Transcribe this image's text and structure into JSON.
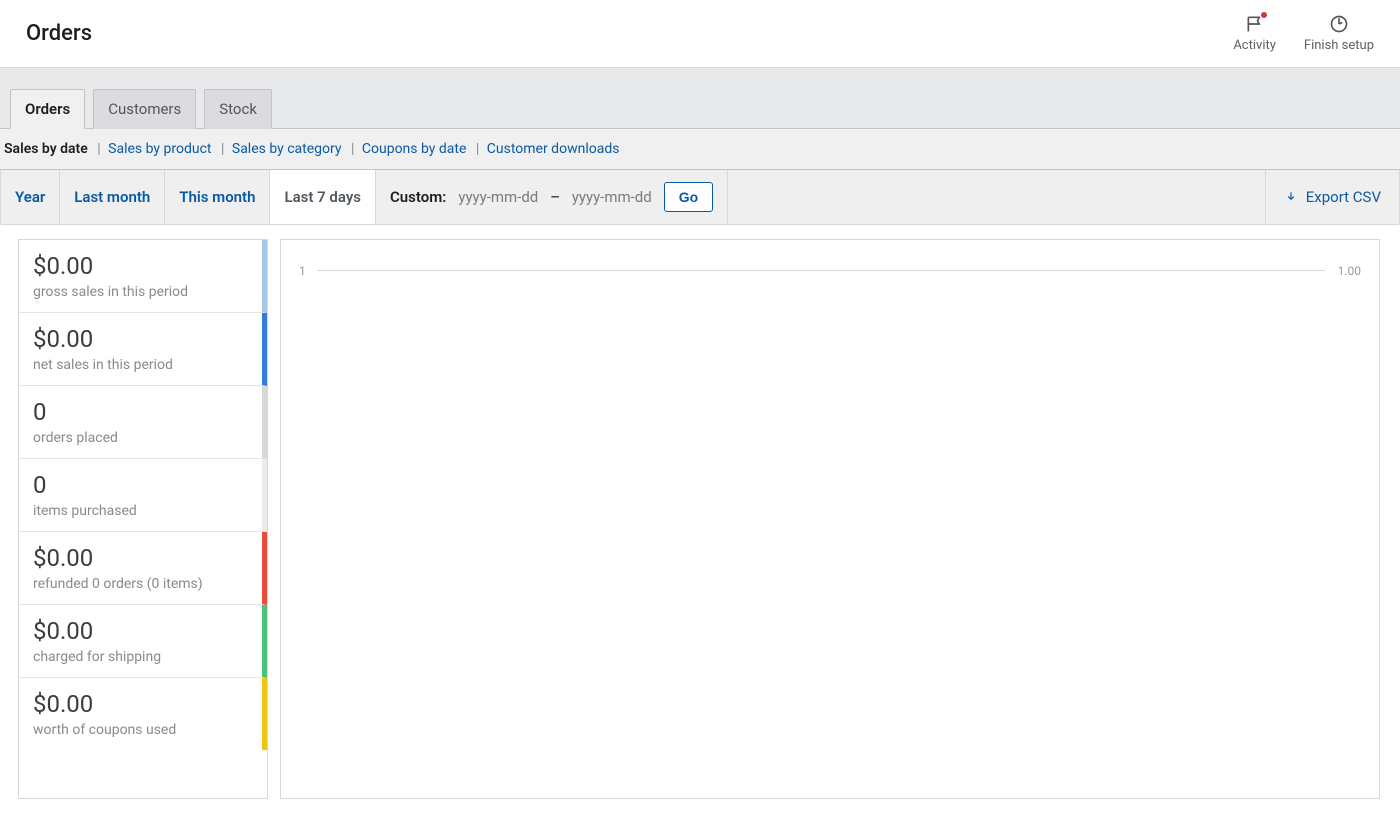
{
  "header": {
    "title": "Orders",
    "activity_label": "Activity",
    "finish_setup_label": "Finish setup"
  },
  "tabs": {
    "orders": "Orders",
    "customers": "Customers",
    "stock": "Stock"
  },
  "subnav": {
    "sales_by_date": "Sales by date",
    "sales_by_product": "Sales by product",
    "sales_by_category": "Sales by category",
    "coupons_by_date": "Coupons by date",
    "customer_downloads": "Customer downloads"
  },
  "range": {
    "year": "Year",
    "last_month": "Last month",
    "this_month": "This month",
    "last_7_days": "Last 7 days",
    "custom_label": "Custom:",
    "from_placeholder": "yyyy-mm-dd",
    "to_placeholder": "yyyy-mm-dd",
    "go": "Go",
    "export": "Export CSV"
  },
  "stats": [
    {
      "value": "$0.00",
      "label": "gross sales in this period",
      "color": "#a6c8e6"
    },
    {
      "value": "$0.00",
      "label": "net sales in this period",
      "color": "#2f7ed8"
    },
    {
      "value": "0",
      "label": "orders placed",
      "color": "#d8d8d8"
    },
    {
      "value": "0",
      "label": "items purchased",
      "color": "#eaeaea"
    },
    {
      "value": "$0.00",
      "label": "refunded 0 orders (0 items)",
      "color": "#e74c3c"
    },
    {
      "value": "$0.00",
      "label": "charged for shipping",
      "color": "#4cc17c"
    },
    {
      "value": "$0.00",
      "label": "worth of coupons used",
      "color": "#f1c40f"
    }
  ],
  "chart_data": {
    "type": "line",
    "title": "",
    "xlabel": "",
    "ylabel": "",
    "xlim": [
      1,
      1
    ],
    "ylim": [
      0,
      1
    ],
    "x_tick_left": "1",
    "x_tick_right": "1.00",
    "series": []
  }
}
